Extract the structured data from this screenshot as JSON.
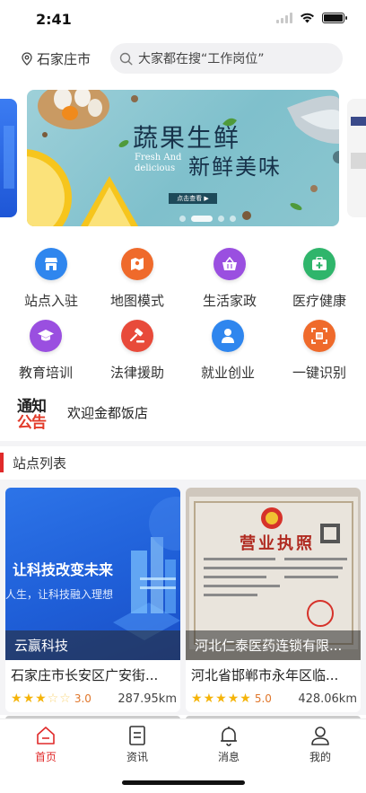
{
  "status_bar": {
    "time": "2:41"
  },
  "header": {
    "city": "石家庄市",
    "search_placeholder": "大家都在搜“工作岗位”"
  },
  "banner": {
    "title_line1": "蔬果生鲜",
    "subtitle_line1": "Fresh And",
    "subtitle_line2": "delicious",
    "title_line2": "新鲜美味",
    "button_label": "点击查看 ▶",
    "page_count": 4,
    "active_page": 1
  },
  "menu": {
    "items": [
      {
        "label": "站点入驻",
        "icon": "store-icon",
        "color": "#2f86ee"
      },
      {
        "label": "地图模式",
        "icon": "map-icon",
        "color": "#ef6a2b"
      },
      {
        "label": "生活家政",
        "icon": "basket-icon",
        "color": "#9a4fe0"
      },
      {
        "label": "医疗健康",
        "icon": "medical-kit-icon",
        "color": "#2fb56b"
      },
      {
        "label": "教育培训",
        "icon": "graduation-cap-icon",
        "color": "#9a4fe0"
      },
      {
        "label": "法律援助",
        "icon": "gavel-icon",
        "color": "#e84a3a"
      },
      {
        "label": "就业创业",
        "icon": "person-icon",
        "color": "#2f86ee"
      },
      {
        "label": "一键识别",
        "icon": "scan-icon",
        "color": "#ef6a2b"
      }
    ]
  },
  "notice": {
    "badge_line1": "通知",
    "badge_line2": "公告",
    "text": "欢迎金都饭店"
  },
  "section": {
    "title": "站点列表"
  },
  "stations": [
    {
      "image_caption_line1": "让科技改变未来",
      "image_caption_line2": "人生，让科技融入理想",
      "name": "云赢科技",
      "address": "石家庄市长安区广安街...",
      "stars": 3,
      "rating": "3.0",
      "distance": "287.95km"
    },
    {
      "image_caption_line1": "营业执照",
      "image_caption_line2": "",
      "name": "河北仁泰医药连锁有限...",
      "address": "河北省邯郸市永年区临...",
      "stars": 5,
      "rating": "5.0",
      "distance": "428.06km"
    }
  ],
  "tabbar": {
    "items": [
      {
        "label": "首页",
        "icon": "home-icon",
        "active": true
      },
      {
        "label": "资讯",
        "icon": "news-icon",
        "active": false
      },
      {
        "label": "消息",
        "icon": "bell-icon",
        "active": false
      },
      {
        "label": "我的",
        "icon": "user-icon",
        "active": false
      }
    ],
    "active_color": "#e02a2a"
  }
}
